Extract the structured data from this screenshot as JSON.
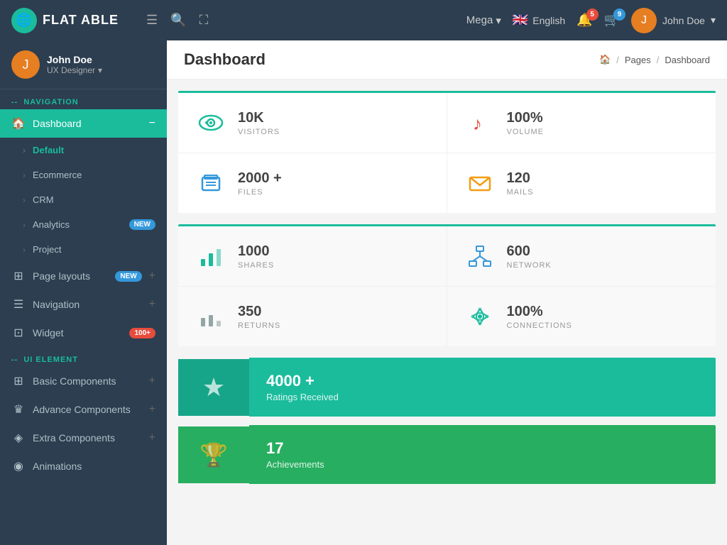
{
  "app": {
    "name": "FLAT ABLE"
  },
  "topnav": {
    "logo_icon": "🌐",
    "menu_icon": "☰",
    "search_icon": "🔍",
    "expand_icon": "⛶",
    "mega_label": "Mega",
    "mega_arrow": "▾",
    "lang_flag": "🇬🇧",
    "lang_label": "English",
    "notif_count": "5",
    "msg_count": "9",
    "user_name": "John Doe",
    "user_arrow": "▾",
    "user_initial": "J"
  },
  "sidebar": {
    "user_name": "John Doe",
    "user_role": "UX Designer",
    "user_initial": "J",
    "nav_section": "NAVIGATION",
    "ui_section": "UI ELEMENT",
    "items": [
      {
        "id": "dashboard",
        "label": "Dashboard",
        "icon": "🏠",
        "active": true,
        "suffix": "minus"
      },
      {
        "id": "default",
        "label": "Default",
        "sub": true,
        "active": true
      },
      {
        "id": "ecommerce",
        "label": "Ecommerce",
        "sub": true
      },
      {
        "id": "crm",
        "label": "CRM",
        "sub": true
      },
      {
        "id": "analytics",
        "label": "Analytics",
        "sub": true,
        "badge": "NEW",
        "badge_type": "new"
      },
      {
        "id": "project",
        "label": "Project",
        "sub": true
      },
      {
        "id": "page-layouts",
        "label": "Page layouts",
        "icon": "⊞",
        "badge": "NEW",
        "badge_type": "new",
        "plus": true
      },
      {
        "id": "navigation",
        "label": "Navigation",
        "icon": "☰",
        "plus": true
      },
      {
        "id": "widget",
        "label": "Widget",
        "icon": "⊡",
        "badge": "100+",
        "badge_type": "red"
      }
    ],
    "ui_items": [
      {
        "id": "basic-components",
        "label": "Basic Components",
        "icon": "⊞",
        "plus": true
      },
      {
        "id": "advance-components",
        "label": "Advance Components",
        "icon": "♛",
        "plus": true
      },
      {
        "id": "extra-components",
        "label": "Extra Components",
        "icon": "◈",
        "plus": true
      },
      {
        "id": "animations",
        "label": "Animations",
        "icon": "◉"
      }
    ]
  },
  "header": {
    "title": "Dashboard",
    "home_icon": "🏠",
    "breadcrumb": [
      "Pages",
      "Dashboard"
    ]
  },
  "stats_row1": [
    {
      "icon": "👁",
      "icon_class": "icon-teal",
      "value": "10K",
      "label": "VISITORS"
    },
    {
      "icon": "♪",
      "icon_class": "icon-red",
      "value": "100%",
      "label": "VOLUME"
    },
    {
      "icon": "🗄",
      "icon_class": "icon-blue",
      "value": "2000 +",
      "label": "FILES"
    },
    {
      "icon": "✉",
      "icon_class": "icon-orange",
      "value": "120",
      "label": "MAILS"
    }
  ],
  "stats_row2": [
    {
      "icon": "📊",
      "icon_class": "icon-teal",
      "value": "1000",
      "label": "SHARES"
    },
    {
      "icon": "🖧",
      "icon_class": "icon-blue",
      "value": "600",
      "label": "NETWORK"
    },
    {
      "icon": "📉",
      "icon_class": "icon-gray",
      "value": "350",
      "label": "RETURNS"
    },
    {
      "icon": "📡",
      "icon_class": "icon-teal",
      "value": "100%",
      "label": "CONNECTIONS"
    }
  ],
  "green_cards": [
    {
      "id": "ratings",
      "icon": "★",
      "value": "4000 +",
      "label": "Ratings Received"
    },
    {
      "id": "achievements",
      "icon": "🏆",
      "value": "17",
      "label": "Achievements"
    }
  ]
}
